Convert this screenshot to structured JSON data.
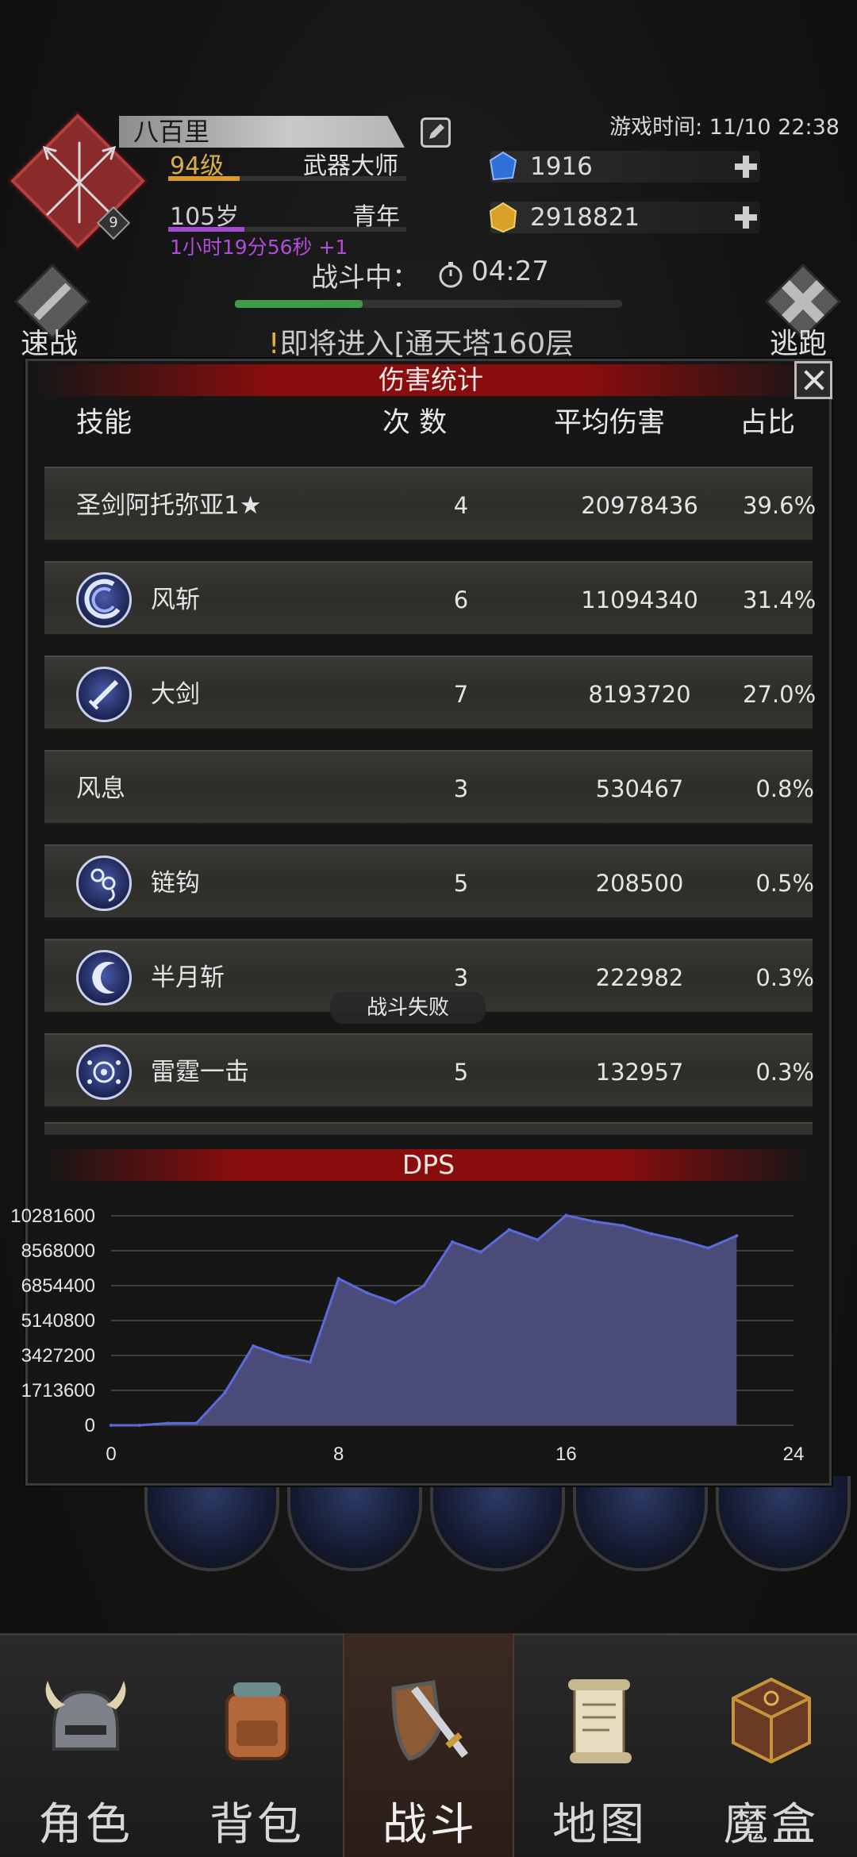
{
  "header": {
    "game_time": "游戏时间: 11/10 22:38",
    "character": {
      "name": "八百里",
      "level_badge": "9",
      "level": "94级",
      "level_title": "武器大师",
      "age": "105岁",
      "age_title": "青年",
      "age_note": "1小时19分56秒 +1"
    },
    "resources": {
      "gems": "1916",
      "gold": "2918821"
    },
    "battle": {
      "status": "战斗中：",
      "timer": "04:27"
    },
    "speed_label": "速战",
    "flee_label": "逃跑",
    "notice_excl": "!",
    "notice": "即将进入[通天塔160层"
  },
  "damage_panel": {
    "title": "伤害统计",
    "columns": [
      "技能",
      "次 数",
      "平均伤害",
      "占比"
    ],
    "rows": [
      {
        "name": "圣剑阿托弥亚1★",
        "count": "4",
        "avg": "20978436",
        "pct": "39.6%",
        "icon": "none"
      },
      {
        "name": "风斩",
        "count": "6",
        "avg": "11094340",
        "pct": "31.4%",
        "icon": "wind-slash-icon"
      },
      {
        "name": "大剑",
        "count": "7",
        "avg": "8193720",
        "pct": "27.0%",
        "icon": "greatsword-icon"
      },
      {
        "name": "风息",
        "count": "3",
        "avg": "530467",
        "pct": "0.8%",
        "icon": "none"
      },
      {
        "name": "链钩",
        "count": "5",
        "avg": "208500",
        "pct": "0.5%",
        "icon": "chain-hook-icon"
      },
      {
        "name": "半月斩",
        "count": "3",
        "avg": "222982",
        "pct": "0.3%",
        "icon": "half-moon-slash-icon"
      },
      {
        "name": "雷霆一击",
        "count": "5",
        "avg": "132957",
        "pct": "0.3%",
        "icon": "thunder-strike-icon"
      }
    ],
    "toast": "战斗失败"
  },
  "chart_data": {
    "type": "area",
    "title": "DPS",
    "xlabel": "",
    "ylabel": "",
    "x_ticks": [
      0,
      8,
      16,
      24
    ],
    "y_ticks": [
      0,
      1713600,
      3427200,
      5140800,
      6854400,
      8568000,
      10281600
    ],
    "xlim": [
      0,
      24
    ],
    "ylim": [
      0,
      10281600
    ],
    "grid": true,
    "colors": {
      "fill": "#4a4b78",
      "line": "#5a6ad8"
    },
    "x": [
      0,
      1,
      2,
      3,
      4,
      5,
      6,
      7,
      8,
      9,
      10,
      11,
      12,
      13,
      14,
      15,
      16,
      17,
      18,
      19,
      20,
      21,
      22
    ],
    "values": [
      0,
      0,
      100000,
      100000,
      1600000,
      3900000,
      3400000,
      3100000,
      7200000,
      6500000,
      6000000,
      6850000,
      9000000,
      8500000,
      9600000,
      9100000,
      10300000,
      10000000,
      9800000,
      9400000,
      9100000,
      8700000,
      9300000
    ]
  },
  "nav": {
    "items": [
      {
        "label": "角色",
        "icon": "helmet-icon"
      },
      {
        "label": "背包",
        "icon": "backpack-icon"
      },
      {
        "label": "战斗",
        "icon": "sword-shield-icon"
      },
      {
        "label": "地图",
        "icon": "scroll-map-icon"
      },
      {
        "label": "魔盒",
        "icon": "magic-box-icon"
      }
    ],
    "active": "战斗"
  }
}
